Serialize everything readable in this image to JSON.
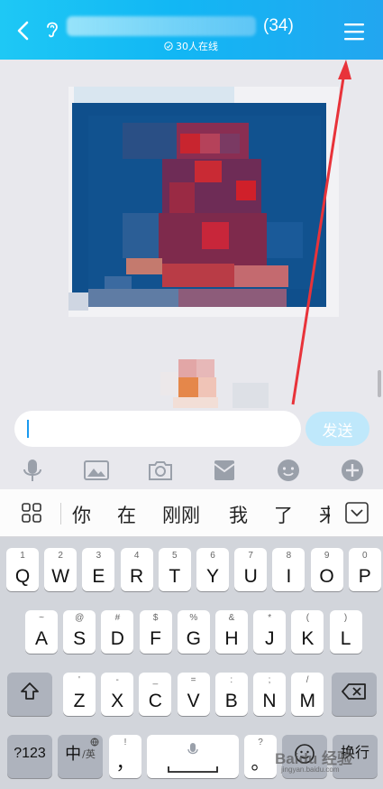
{
  "header": {
    "member_count": "(34)",
    "online_status": "30人在线"
  },
  "composer": {
    "send_label": "发送"
  },
  "ime": {
    "candidates": [
      "你",
      "在",
      "刚刚",
      "我",
      "了",
      "来"
    ]
  },
  "keyboard": {
    "row1": [
      {
        "sub": "1",
        "main": "Q"
      },
      {
        "sub": "2",
        "main": "W"
      },
      {
        "sub": "3",
        "main": "E"
      },
      {
        "sub": "4",
        "main": "R"
      },
      {
        "sub": "5",
        "main": "T"
      },
      {
        "sub": "6",
        "main": "Y"
      },
      {
        "sub": "7",
        "main": "U"
      },
      {
        "sub": "8",
        "main": "I"
      },
      {
        "sub": "9",
        "main": "O"
      },
      {
        "sub": "0",
        "main": "P"
      }
    ],
    "row2": [
      {
        "sub": "~",
        "main": "A"
      },
      {
        "sub": "@",
        "main": "S"
      },
      {
        "sub": "#",
        "main": "D"
      },
      {
        "sub": "$",
        "main": "F"
      },
      {
        "sub": "%",
        "main": "G"
      },
      {
        "sub": "&",
        "main": "H"
      },
      {
        "sub": "*",
        "main": "J"
      },
      {
        "sub": "(",
        "main": "K"
      },
      {
        "sub": ")",
        "main": "L"
      }
    ],
    "row3": [
      {
        "sub": "'",
        "main": "Z"
      },
      {
        "sub": "-",
        "main": "X"
      },
      {
        "sub": "_",
        "main": "C"
      },
      {
        "sub": "=",
        "main": "V"
      },
      {
        "sub": ":",
        "main": "B"
      },
      {
        "sub": ";",
        "main": "N"
      },
      {
        "sub": "/",
        "main": "M"
      }
    ],
    "row4": {
      "numbers": "?123",
      "lang_main": "中",
      "lang_sub": "/英",
      "comma_sub": "!",
      "comma": "，",
      "period_sub": "?",
      "period": "。",
      "enter": "换行"
    }
  },
  "watermark": {
    "brand": "Baidu 经验",
    "url": "jingyan.baidu.com"
  },
  "colors": {
    "header_start": "#1ec8f5",
    "header_end": "#22a6f0",
    "send_disabled": "#bfe8fb",
    "annotation_arrow": "#e8333a"
  }
}
